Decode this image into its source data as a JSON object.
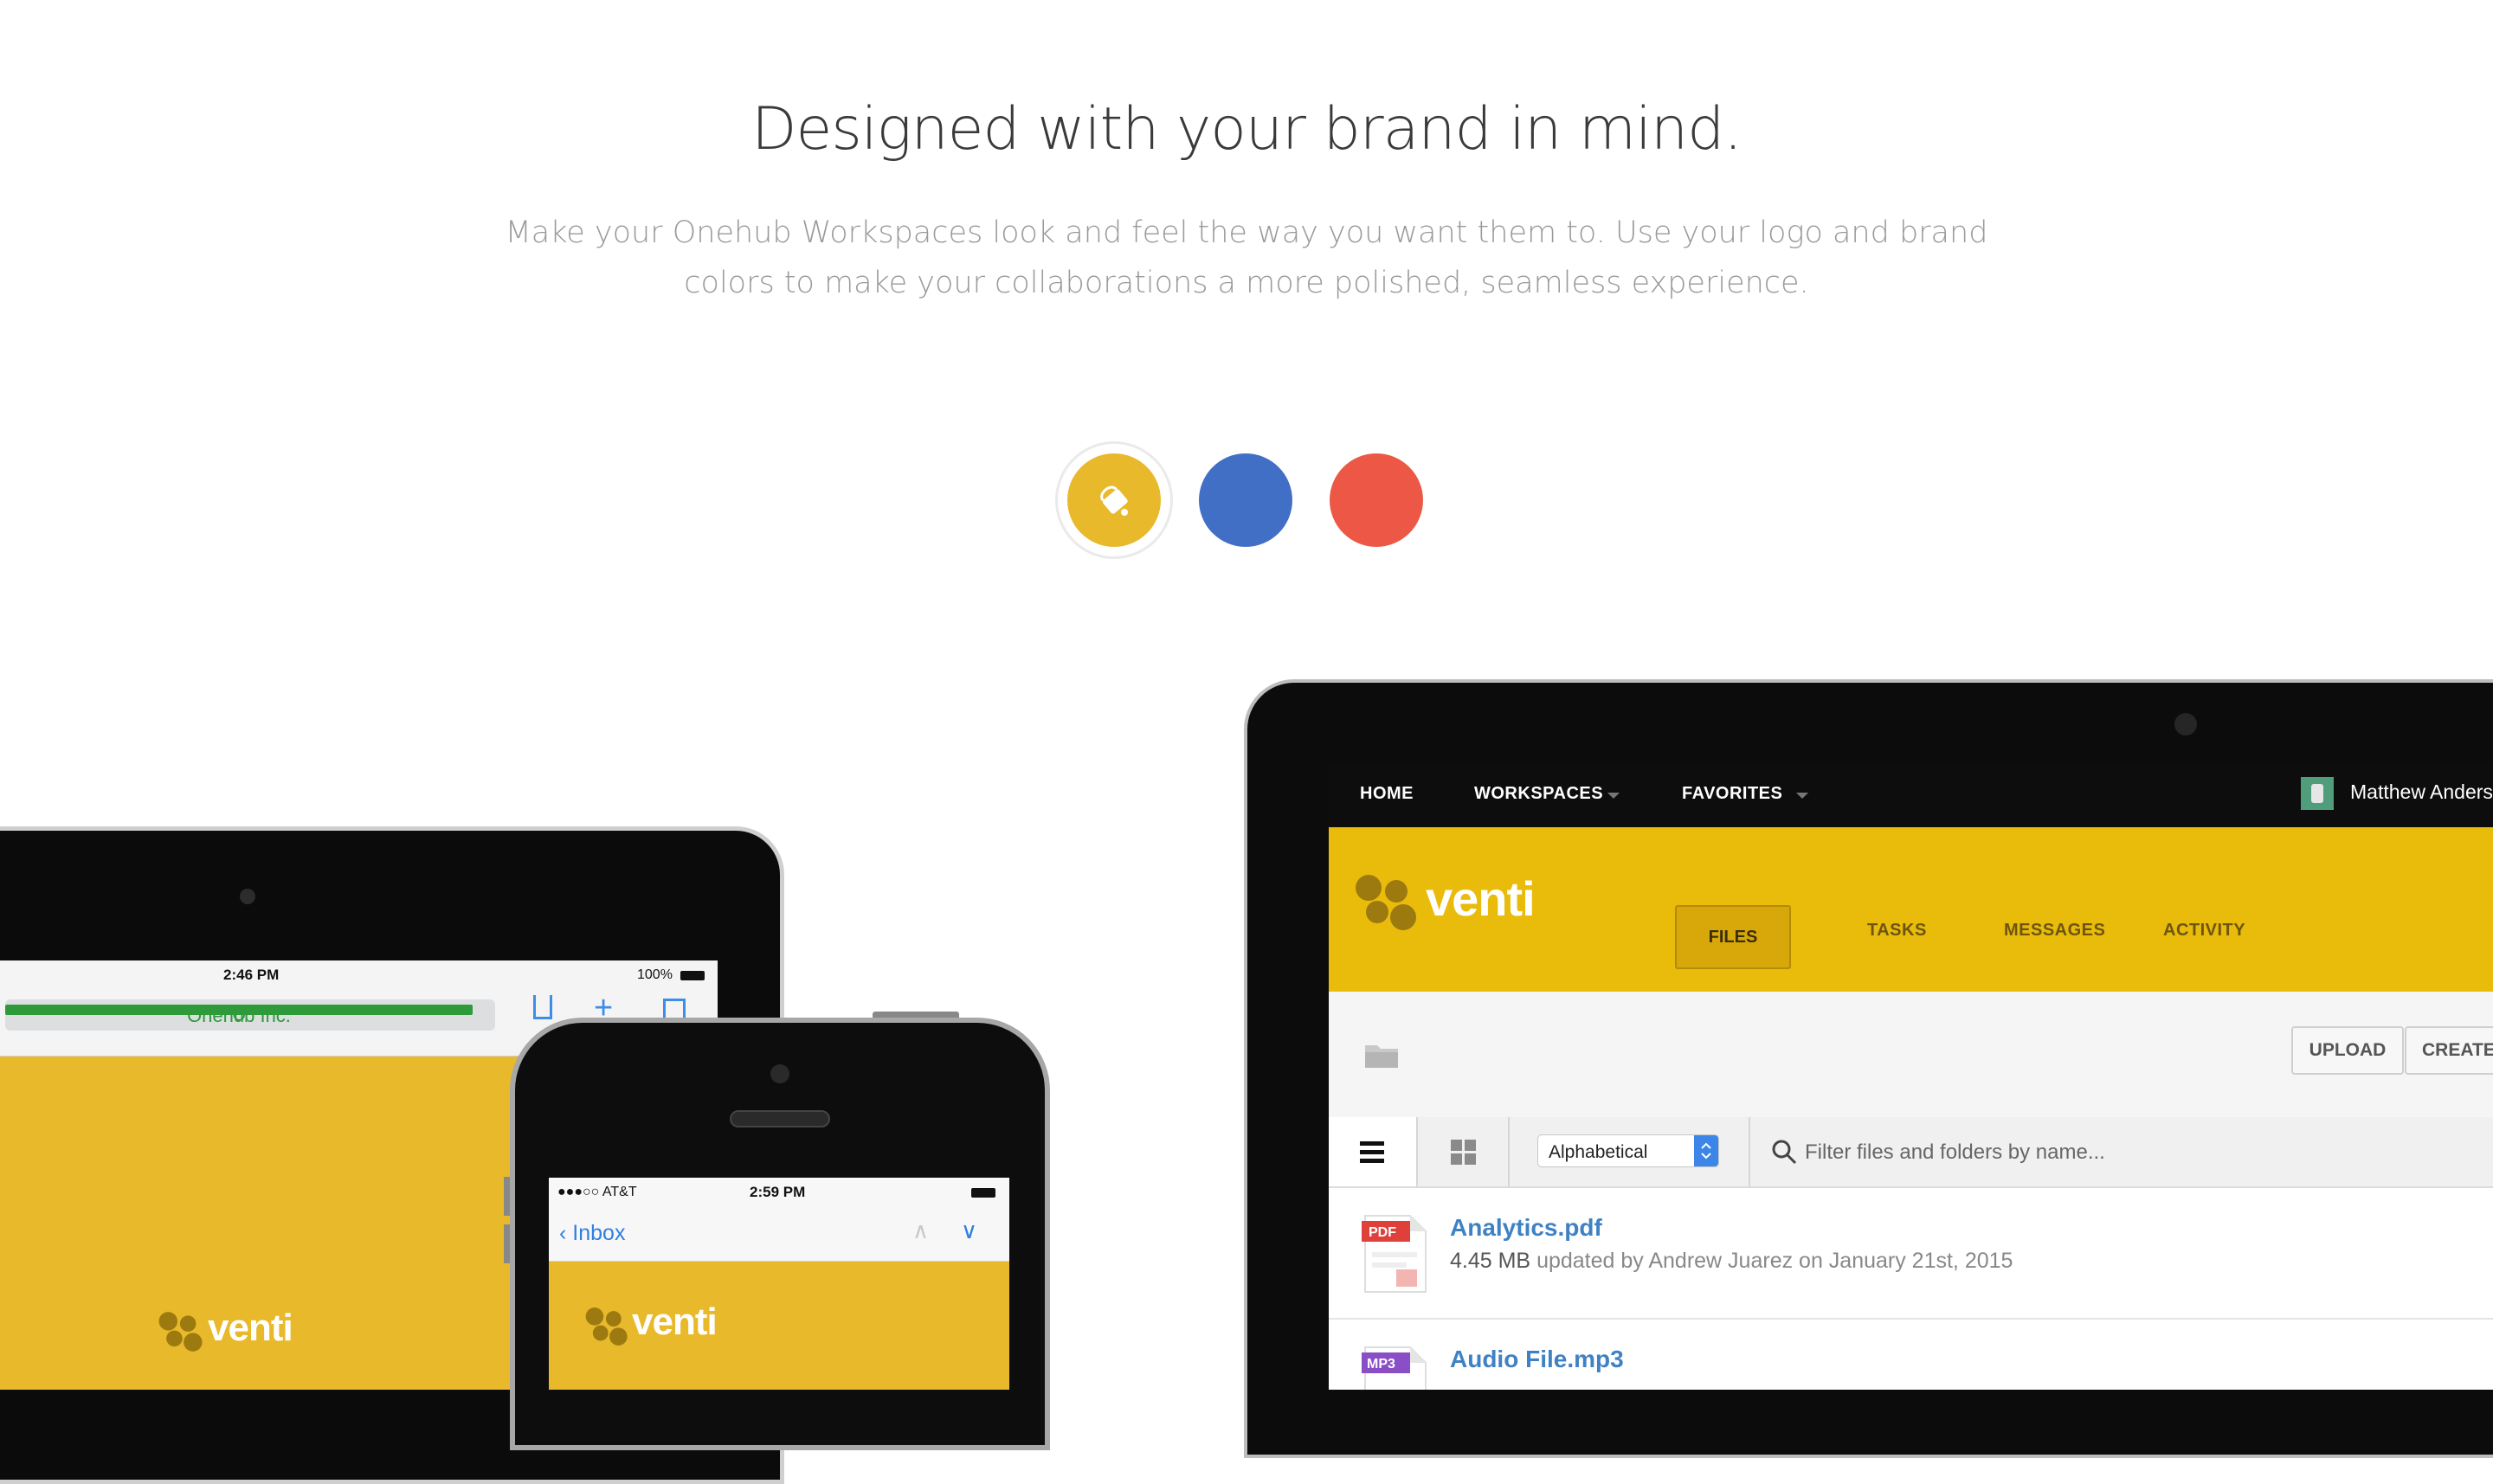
{
  "hero": {
    "title": "Designed with your brand in mind.",
    "subtitle": "Make your Onehub Workspaces look and feel the way you want them to. Use your logo and brand colors to make your collaborations a more polished, seamless experience."
  },
  "swatches": [
    {
      "name": "yellow",
      "color": "#e9b92c",
      "selected": true,
      "icon": "paint-bucket-icon"
    },
    {
      "name": "blue",
      "color": "#426fc6",
      "selected": false
    },
    {
      "name": "red",
      "color": "#ec5845",
      "selected": false
    }
  ],
  "laptop": {
    "topnav": {
      "home": "HOME",
      "workspaces": "WORKSPACES",
      "favorites": "FAVORITES",
      "user": "Matthew Anders"
    },
    "brand": {
      "name": "venti",
      "color": "#e9bb0a"
    },
    "tabs": [
      "FILES",
      "TASKS",
      "MESSAGES",
      "ACTIVITY"
    ],
    "active_tab": "FILES",
    "buttons": {
      "upload": "UPLOAD",
      "create": "CREATE"
    },
    "sort": {
      "value": "Alphabetical"
    },
    "search": {
      "placeholder": "Filter files and folders by name..."
    },
    "files": [
      {
        "name": "Analytics.pdf",
        "type_label": "PDF",
        "size": "4.45 MB",
        "meta": "updated by Andrew Juarez on January 21st, 2015",
        "icon_color": "#e0403a"
      },
      {
        "name": "Audio File.mp3",
        "type_label": "MP3",
        "size": "",
        "meta": "",
        "icon_color": "#8a4fc7"
      }
    ]
  },
  "tablet": {
    "time": "2:46 PM",
    "battery": "100%",
    "url": "Onehub Inc.",
    "brand": "venti"
  },
  "phone": {
    "carrier": "●●●○○ AT&T",
    "time": "2:59 PM",
    "back_label": "Inbox",
    "brand": "venti"
  }
}
